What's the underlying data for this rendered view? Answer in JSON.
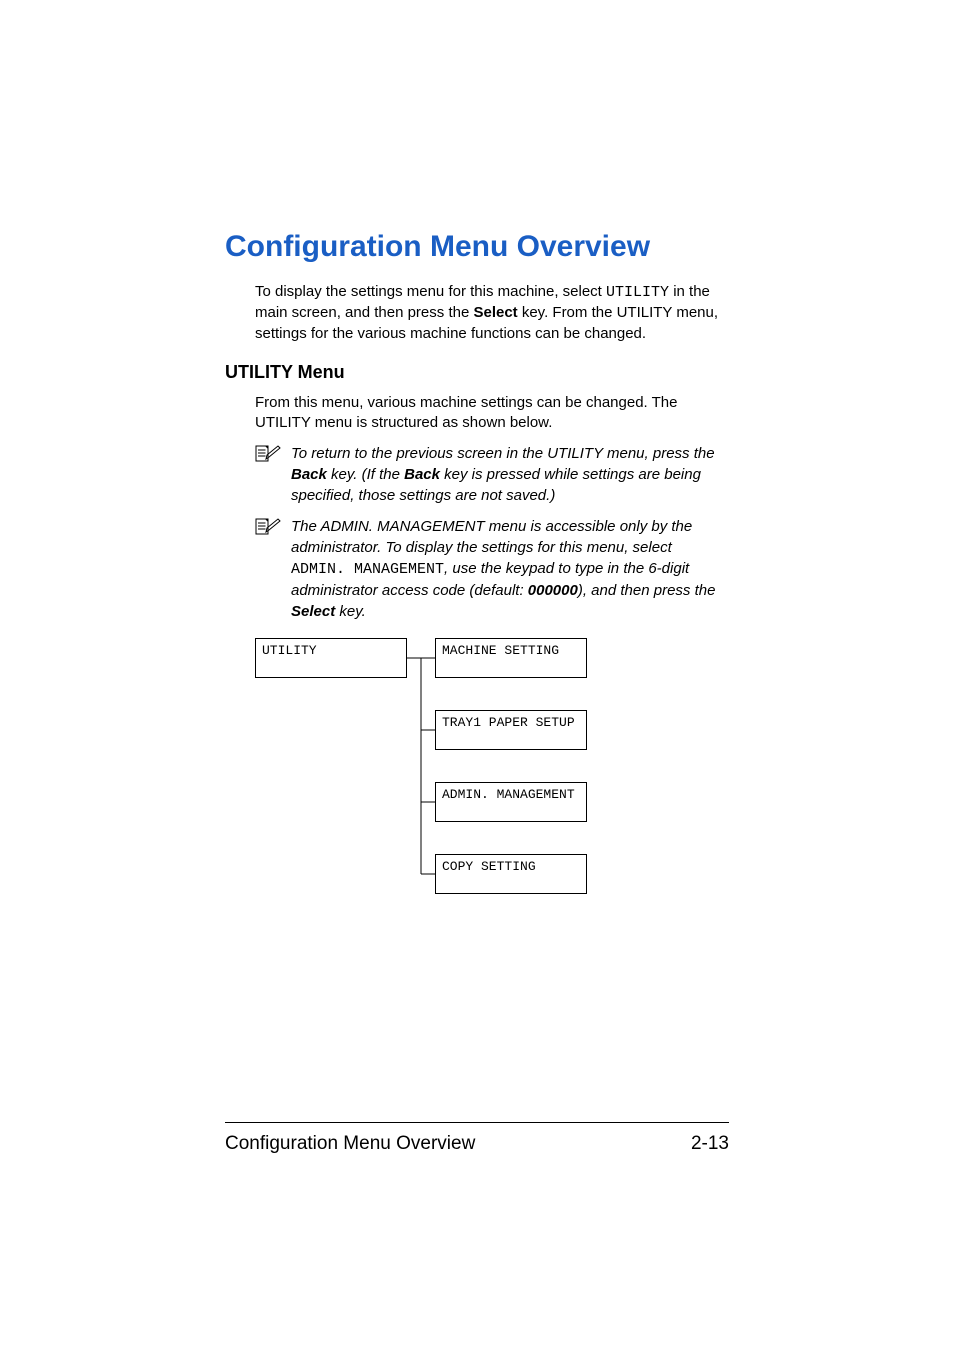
{
  "title": "Configuration Menu Overview",
  "intro": {
    "p1a": "To display the settings menu for this machine, select ",
    "p1_code": "UTILITY",
    "p1b": " in the main screen, and then press the ",
    "p1_bold": "Select",
    "p1c": " key. From the UTILITY menu, settings for the various machine functions can be changed."
  },
  "section_heading": "UTILITY Menu",
  "section_para": "From this menu, various machine settings can be changed. The UTILITY menu is structured as shown below.",
  "note1": {
    "a": "To return to the previous screen in the UTILITY menu, press the ",
    "b_bold": "Back",
    "c": " key. (If the ",
    "d_bold": "Back",
    "e": " key is pressed while settings are being specified, those settings are not saved.)"
  },
  "note2": {
    "a": "The ADMIN. MANAGEMENT menu is accessible only by the administrator. To display the settings for this menu, select ",
    "b_code": "ADMIN. MANAGEMENT",
    "c": ", use the keypad to type in the 6-digit administrator access code (default: ",
    "d_bold": "000000",
    "e": "), and then press the ",
    "f_bold": "Select",
    "g": " key."
  },
  "diagram": {
    "root": "UTILITY",
    "items": [
      "MACHINE SETTING",
      "TRAY1 PAPER SETUP",
      "ADMIN. MANAGEMENT",
      "COPY SETTING"
    ]
  },
  "footer": {
    "left": "Configuration Menu Overview",
    "right": "2-13"
  }
}
